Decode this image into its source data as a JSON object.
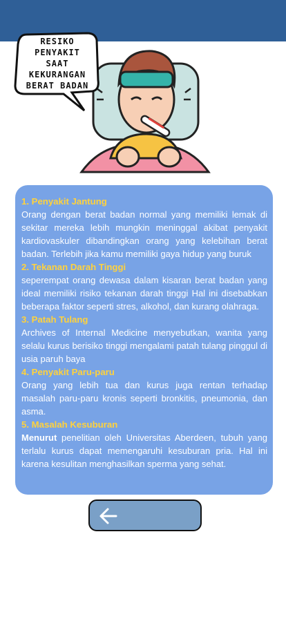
{
  "header": {
    "color": "#2f5f97"
  },
  "illustration": {
    "icon": "sick-person-icon",
    "bubble_text": "RESIKO\nPENYAKIT\nSAAT\nKEKURANGAN\nBERAT BADAN"
  },
  "content": {
    "items": [
      {
        "heading": "1. Penyakit Jantung",
        "text": "Orang dengan berat badan normal yang memiliki lemak di sekitar mereka lebih mungkin meninggal akibat penyakit kardiovaskuler dibandingkan orang yang kelebihan berat badan. Terlebih jika kamu memiliki gaya hidup yang buruk"
      },
      {
        "heading": "2. Tekanan Darah Tinggi",
        "text": "seperempat orang dewasa dalam kisaran berat badan yang ideal memiliki risiko  tekanan darah tinggi Hal ini disebabkan beberapa faktor seperti stres, alkohol, dan kurang olahraga."
      },
      {
        "heading": "3. Patah Tulang",
        "text": "Archives of Internal Medicine menyebutkan, wanita yang selalu kurus berisiko tinggi mengalami patah tulang pinggul di usia paruh baya"
      },
      {
        "heading": "4. Penyakit Paru-paru",
        "text": "Orang yang lebih tua dan kurus juga rentan terhadap masalah paru-paru kronis seperti bronkitis, pneumonia, dan asma."
      },
      {
        "heading": "5. Masalah Kesuburan",
        "bold_lead": "Menurut",
        "text": " penelitian oleh Universitas Aberdeen, tubuh yang terlalu kurus dapat memengaruhi kesuburan pria. Hal ini karena kesulitan menghasilkan sperma yang sehat."
      }
    ]
  },
  "back_button": {
    "icon": "arrow-left-icon"
  }
}
